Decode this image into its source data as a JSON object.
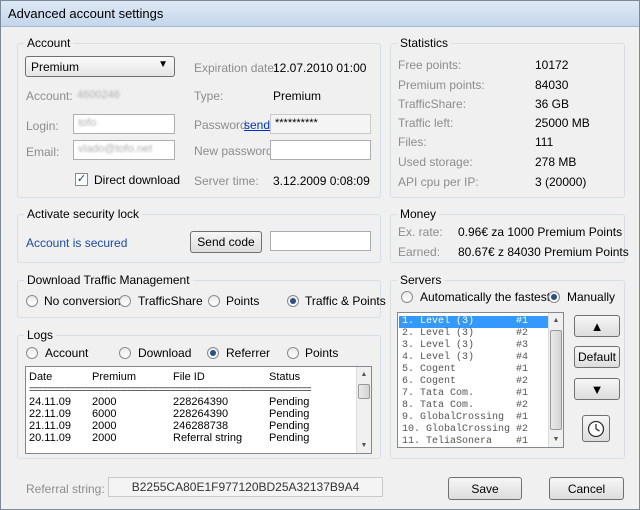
{
  "window": {
    "title": "Advanced account settings"
  },
  "account": {
    "group_title": "Account",
    "type_select": "Premium",
    "account_label": "Account:",
    "account_value": "4600246",
    "login_label": "Login:",
    "login_value": "tofo",
    "email_label": "Email:",
    "email_value": "vlado@tofo.net",
    "direct_download_label": "Direct download",
    "direct_download_checked": true,
    "expiration_label": "Expiration date:",
    "expiration_value": "12.07.2010 01:00",
    "type_label": "Type:",
    "type_value": "Premium",
    "password_label": "Password:",
    "password_send_link": "send",
    "password_value": "**********",
    "new_password_label": "New password:",
    "new_password_value": "",
    "server_time_label": "Server time:",
    "server_time_value": "3.12.2009 0:08:09"
  },
  "statistics": {
    "group_title": "Statistics",
    "rows": [
      {
        "label": "Free points:",
        "value": "10172"
      },
      {
        "label": "Premium points:",
        "value": "84030"
      },
      {
        "label": "TrafficShare:",
        "value": "36 GB"
      },
      {
        "label": "Traffic left:",
        "value": "25000 MB"
      },
      {
        "label": "Files:",
        "value": "111"
      },
      {
        "label": "Used storage:",
        "value": "278 MB"
      },
      {
        "label": "API cpu per IP:",
        "value": "3 (20000)"
      }
    ]
  },
  "security": {
    "group_title": "Activate security lock",
    "status": "Account is secured",
    "send_code_button": "Send code",
    "code_value": ""
  },
  "money": {
    "group_title": "Money",
    "rate_label": "Ex. rate:",
    "rate_value": "0.96€ za 1000 Premium Points",
    "earned_label": "Earned:",
    "earned_value": "80.67€ z 84030 Premium Points"
  },
  "traffic": {
    "group_title": "Download Traffic Management",
    "options": [
      "No conversion",
      "TrafficShare",
      "Points",
      "Traffic & Points"
    ],
    "selected": 3
  },
  "logs": {
    "group_title": "Logs",
    "filters": [
      "Account",
      "Download",
      "Referrer",
      "Points"
    ],
    "selected_filter": 2,
    "headers": [
      "Date",
      "Premium",
      "File ID",
      "Status"
    ],
    "separator": "================================================================",
    "rows": [
      [
        "24.11.09",
        "2000",
        "228264390",
        "Pending"
      ],
      [
        "22.11.09",
        "6000",
        "228264390",
        "Pending"
      ],
      [
        "21.11.09",
        "2000",
        "246288738",
        "Pending"
      ],
      [
        "20.11.09",
        "2000",
        "Referral string",
        "Pending"
      ]
    ]
  },
  "servers": {
    "group_title": "Servers",
    "mode_options": [
      "Automatically the fastest",
      "Manually"
    ],
    "selected_mode": 1,
    "items": [
      {
        "name": "1. Level (3)",
        "tag": "#1"
      },
      {
        "name": "2. Level (3)",
        "tag": "#2"
      },
      {
        "name": "3. Level (3)",
        "tag": "#3"
      },
      {
        "name": "4. Level (3)",
        "tag": "#4"
      },
      {
        "name": "5. Cogent",
        "tag": "#1"
      },
      {
        "name": "6. Cogent",
        "tag": "#2"
      },
      {
        "name": "7. Tata Com.",
        "tag": "#1"
      },
      {
        "name": "8. Tata Com.",
        "tag": "#2"
      },
      {
        "name": "9. GlobalCrossing",
        "tag": "#1"
      },
      {
        "name": "10. GlobalCrossing",
        "tag": "#2"
      },
      {
        "name": "11. TeliaSonera",
        "tag": "#1"
      }
    ],
    "selected_index": 0,
    "up_glyph": "▲",
    "down_glyph": "▼",
    "default_button": "Default",
    "clock_glyph": "🕓"
  },
  "footer": {
    "referral_label": "Referral string:",
    "referral_value": "B2255CA80E1F977120BD25A32137B9A4",
    "save_button": "Save",
    "cancel_button": "Cancel"
  }
}
